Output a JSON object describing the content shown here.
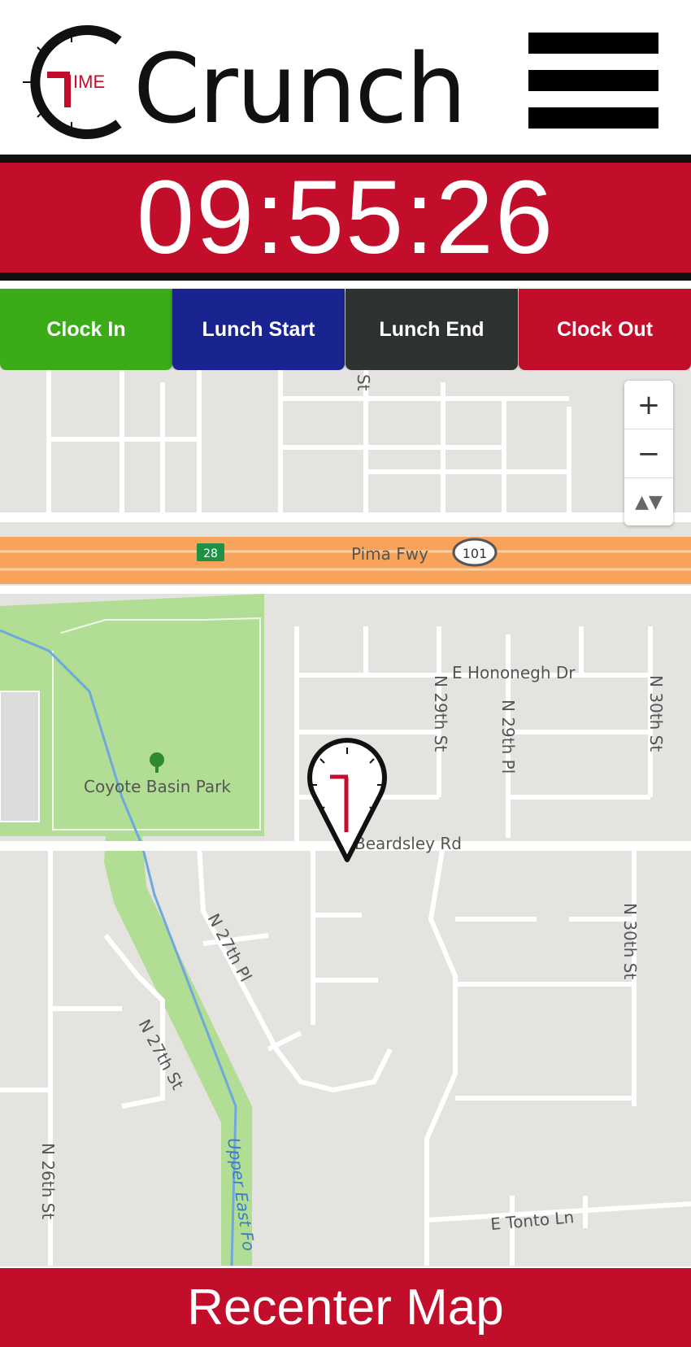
{
  "app": {
    "logo_main": "Crunch",
    "logo_small": "IME"
  },
  "timer": {
    "value": "09:55:26"
  },
  "actions": {
    "clock_in": "Clock In",
    "lunch_start": "Lunch Start",
    "lunch_end": "Lunch End",
    "clock_out": "Clock Out"
  },
  "map": {
    "labels": {
      "pima": "Pima Fwy",
      "route101": "101",
      "route28": "28",
      "honoegh": "E Hononegh Dr",
      "n29st": "N 29th St",
      "n29pl": "N 29th Pl",
      "n30st_top": "N 30th St",
      "n30st_bottom": "N 30th St",
      "park": "Coyote Basin Park",
      "beardsley": "Beardsley Rd",
      "n27pl": "N 27th Pl",
      "n27st": "N 27th St",
      "n26st": "N 26th St",
      "upper": "Upper East Fo",
      "tonto": "E Tonto Ln",
      "st_top": "St"
    },
    "zoom": {
      "in": "+",
      "out": "−",
      "reset": "▲▼"
    }
  },
  "recenter": {
    "label": "Recenter Map"
  },
  "colors": {
    "brand_red": "#c20e2a",
    "clock_in": "#3bab18",
    "lunch_start": "#1a2490",
    "lunch_end": "#2e3331"
  }
}
